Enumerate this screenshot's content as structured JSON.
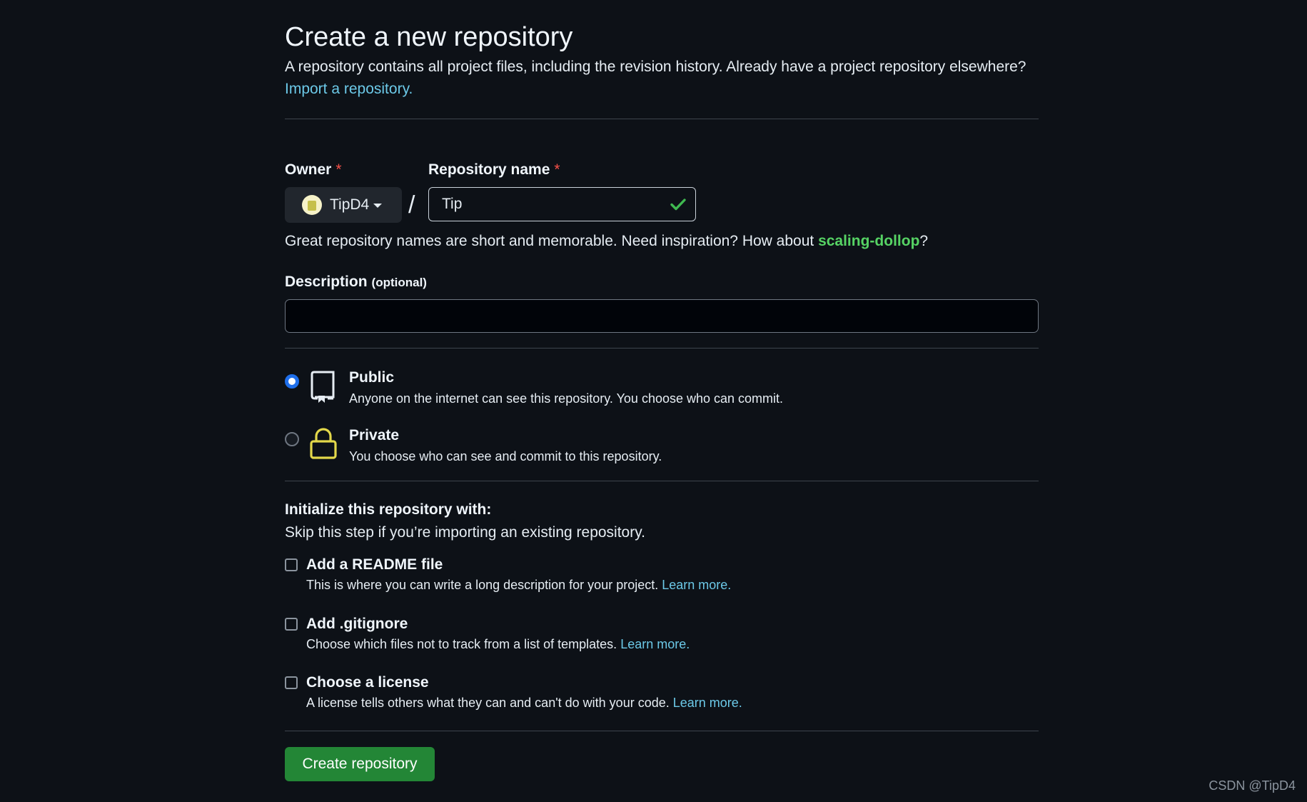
{
  "page": {
    "title": "Create a new repository",
    "subtitle_text": "A repository contains all project files, including the revision history. Already have a project repository elsewhere?",
    "import_link": "Import a repository."
  },
  "owner": {
    "label": "Owner",
    "required_mark": "*",
    "value": "TipD4"
  },
  "repo_name": {
    "label": "Repository name",
    "required_mark": "*",
    "value": "Tip",
    "valid": true
  },
  "name_hint": {
    "text": "Great repository names are short and memorable. Need inspiration? How about ",
    "suggestion": "scaling-dollop",
    "suffix": "?"
  },
  "description": {
    "label": "Description",
    "optional": "(optional)",
    "value": ""
  },
  "visibility": {
    "options": [
      {
        "title": "Public",
        "desc": "Anyone on the internet can see this repository. You choose who can commit.",
        "icon": "repo-icon",
        "selected": true
      },
      {
        "title": "Private",
        "desc": "You choose who can see and commit to this repository.",
        "icon": "lock-icon",
        "selected": false
      }
    ]
  },
  "initialize": {
    "heading": "Initialize this repository with:",
    "sub": "Skip this step if you’re importing an existing repository.",
    "items": [
      {
        "title": "Add a README file",
        "desc": "This is where you can write a long description for your project.",
        "link": "Learn more.",
        "checked": false
      },
      {
        "title": "Add .gitignore",
        "desc": "Choose which files not to track from a list of templates.",
        "link": "Learn more.",
        "checked": false
      },
      {
        "title": "Choose a license",
        "desc": "A license tells others what they can and can't do with your code.",
        "link": "Learn more.",
        "checked": false
      }
    ]
  },
  "submit": {
    "label": "Create repository"
  },
  "watermark": "CSDN @TipD4",
  "colors": {
    "background": "#0d1117",
    "accent_green": "#238636",
    "suggestion_green": "#56d364",
    "link_cyan": "#6cc9e8",
    "radio_blue": "#1f6feb",
    "lock_yellow": "#e3d84a"
  }
}
